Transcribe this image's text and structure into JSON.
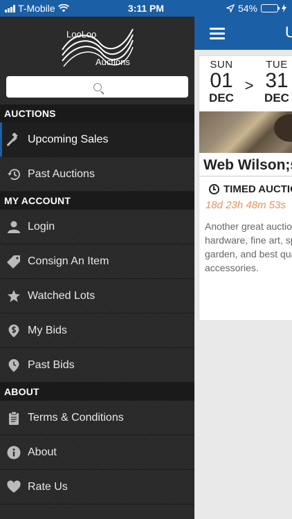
{
  "status_bar": {
    "carrier": "T-Mobile",
    "time": "3:11 PM",
    "battery": "54%",
    "battery_fill": 0.54
  },
  "drawer": {
    "logo": {
      "line1": "LooLoo",
      "line2": "Auctions"
    },
    "search": {
      "placeholder": ""
    },
    "sections": [
      {
        "title": "AUCTIONS",
        "items": [
          {
            "label": "Upcoming Sales",
            "icon": "gavel-icon",
            "active": true
          },
          {
            "label": "Past Auctions",
            "icon": "history-icon",
            "active": false
          }
        ]
      },
      {
        "title": "MY ACCOUNT",
        "items": [
          {
            "label": "Login",
            "icon": "user-icon"
          },
          {
            "label": "Consign An Item",
            "icon": "tag-icon"
          },
          {
            "label": "Watched Lots",
            "icon": "star-icon"
          },
          {
            "label": "My Bids",
            "icon": "dollar-pin-icon"
          },
          {
            "label": "Past Bids",
            "icon": "clock-pin-icon"
          }
        ]
      },
      {
        "title": "ABOUT",
        "items": [
          {
            "label": "Terms & Conditions",
            "icon": "clipboard-icon"
          },
          {
            "label": "About",
            "icon": "info-icon"
          },
          {
            "label": "Rate Us",
            "icon": "heart-icon"
          }
        ]
      }
    ]
  },
  "content": {
    "title": "U",
    "card": {
      "start": {
        "dow": "SUN",
        "day": "01",
        "month": "DEC"
      },
      "separator": ">",
      "end": {
        "dow": "TUE",
        "day": "31",
        "month": "DEC"
      },
      "title": "Web Wilson;s",
      "type": "TIMED AUCTION",
      "countdown": "18d 23h 48m 53s",
      "description": "Another great auction of hardware, fine art, sports, garden, and best quality and accessories."
    }
  },
  "colors": {
    "brand_blue": "#1b5fa6",
    "countdown_orange": "#e8935a",
    "drawer_bg": "#2b2b2b",
    "section_bg": "#1a1a1a"
  }
}
